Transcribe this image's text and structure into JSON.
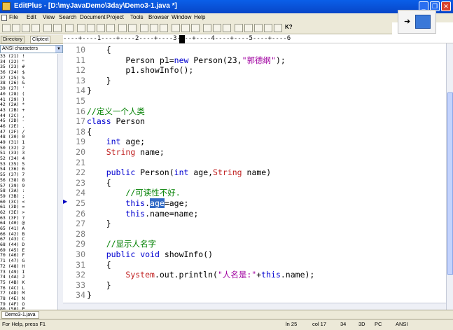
{
  "title_bar": {
    "title": "EditPlus - [D:\\myJavaDemo\\3day\\Demo3-1.java *]",
    "minimize": "_",
    "restore": "❐",
    "close": "✕"
  },
  "menu": {
    "items": [
      "File",
      "Edit",
      "View",
      "Search",
      "Document",
      "Project",
      "Tools",
      "Browser",
      "Window",
      "Help"
    ]
  },
  "toolbar": {
    "help_label": "K?"
  },
  "left_panel": {
    "tabs": [
      "Directory",
      "Cliptext"
    ],
    "selected_list": "ANSI characters",
    "chars": [
      [
        "33 (21)",
        "!"
      ],
      [
        "34 (22)",
        "\""
      ],
      [
        "35 (23)",
        "#"
      ],
      [
        "36 (24)",
        "$"
      ],
      [
        "37 (25)",
        "%"
      ],
      [
        "38 (26)",
        "&"
      ],
      [
        "39 (27)",
        "'"
      ],
      [
        "40 (28)",
        "("
      ],
      [
        "41 (29)",
        ")"
      ],
      [
        "42 (2A)",
        "*"
      ],
      [
        "43 (2B)",
        "+"
      ],
      [
        "44 (2C)",
        ","
      ],
      [
        "45 (2D)",
        "-"
      ],
      [
        "46 (2E)",
        "."
      ],
      [
        "47 (2F)",
        "/"
      ],
      [
        "48 (30)",
        "0"
      ],
      [
        "49 (31)",
        "1"
      ],
      [
        "50 (32)",
        "2"
      ],
      [
        "51 (33)",
        "3"
      ],
      [
        "52 (34)",
        "4"
      ],
      [
        "53 (35)",
        "5"
      ],
      [
        "54 (36)",
        "6"
      ],
      [
        "55 (37)",
        "7"
      ],
      [
        "56 (38)",
        "8"
      ],
      [
        "57 (39)",
        "9"
      ],
      [
        "58 (3A)",
        ":"
      ],
      [
        "59 (3B)",
        ";"
      ],
      [
        "60 (3C)",
        "<"
      ],
      [
        "61 (3D)",
        "="
      ],
      [
        "62 (3E)",
        ">"
      ],
      [
        "63 (3F)",
        "?"
      ],
      [
        "64 (40)",
        "@"
      ],
      [
        "65 (41)",
        "A"
      ],
      [
        "66 (42)",
        "B"
      ],
      [
        "67 (43)",
        "C"
      ],
      [
        "68 (44)",
        "D"
      ],
      [
        "69 (45)",
        "E"
      ],
      [
        "70 (46)",
        "F"
      ],
      [
        "71 (47)",
        "G"
      ],
      [
        "72 (48)",
        "H"
      ],
      [
        "73 (49)",
        "I"
      ],
      [
        "74 (4A)",
        "J"
      ],
      [
        "75 (4B)",
        "K"
      ],
      [
        "76 (4C)",
        "L"
      ],
      [
        "77 (4D)",
        "M"
      ],
      [
        "78 (4E)",
        "N"
      ],
      [
        "79 (4F)",
        "O"
      ],
      [
        "80 (50)",
        "P"
      ]
    ]
  },
  "ruler": {
    "text": "----+----1----+----2----+----3----+----4----+----5----+----6"
  },
  "code_lines": [
    {
      "n": "10",
      "indent": "    ",
      "parts": [
        [
          "p",
          "{"
        ]
      ]
    },
    {
      "n": "11",
      "indent": "        ",
      "parts": [
        [
          "p",
          "Person p1="
        ],
        [
          "kw",
          "new"
        ],
        [
          "p",
          " Person(23,"
        ],
        [
          "str",
          "\"郭德纲\""
        ],
        [
          "p",
          ");"
        ]
      ]
    },
    {
      "n": "12",
      "indent": "        ",
      "parts": [
        [
          "p",
          "p1.showInfo();"
        ]
      ]
    },
    {
      "n": "13",
      "indent": "    ",
      "parts": [
        [
          "p",
          "}"
        ]
      ]
    },
    {
      "n": "14",
      "indent": "",
      "parts": [
        [
          "p",
          "}"
        ]
      ]
    },
    {
      "n": "15",
      "indent": "",
      "parts": []
    },
    {
      "n": "16",
      "indent": "",
      "parts": [
        [
          "cmt",
          "//定义一个人类"
        ]
      ]
    },
    {
      "n": "17",
      "indent": "",
      "parts": [
        [
          "kw",
          "class"
        ],
        [
          "p",
          " Person"
        ]
      ]
    },
    {
      "n": "18",
      "indent": "",
      "parts": [
        [
          "p",
          "{"
        ]
      ]
    },
    {
      "n": "19",
      "indent": "    ",
      "parts": [
        [
          "kw",
          "int"
        ],
        [
          "p",
          " age;"
        ]
      ]
    },
    {
      "n": "20",
      "indent": "    ",
      "parts": [
        [
          "ty",
          "String"
        ],
        [
          "p",
          " name;"
        ]
      ]
    },
    {
      "n": "21",
      "indent": "",
      "parts": []
    },
    {
      "n": "22",
      "indent": "    ",
      "parts": [
        [
          "kw",
          "public"
        ],
        [
          "p",
          " Person("
        ],
        [
          "kw",
          "int"
        ],
        [
          "p",
          " age,"
        ],
        [
          "ty",
          "String"
        ],
        [
          "p",
          " name)"
        ]
      ]
    },
    {
      "n": "23",
      "indent": "    ",
      "parts": [
        [
          "p",
          "{"
        ]
      ]
    },
    {
      "n": "24",
      "indent": "        ",
      "parts": [
        [
          "cmt",
          "//可读性不好."
        ]
      ]
    },
    {
      "n": "25",
      "indent": "        ",
      "parts": [
        [
          "kw",
          "this"
        ],
        [
          "p",
          "."
        ],
        [
          "sel",
          "age"
        ],
        [
          "p",
          "=age;"
        ]
      ]
    },
    {
      "n": "26",
      "indent": "        ",
      "parts": [
        [
          "kw",
          "this"
        ],
        [
          "p",
          ".name=name;"
        ]
      ]
    },
    {
      "n": "27",
      "indent": "    ",
      "parts": [
        [
          "p",
          "}"
        ]
      ]
    },
    {
      "n": "28",
      "indent": "",
      "parts": []
    },
    {
      "n": "29",
      "indent": "    ",
      "parts": [
        [
          "cmt",
          "//显示人名字"
        ]
      ]
    },
    {
      "n": "30",
      "indent": "    ",
      "parts": [
        [
          "kw",
          "public"
        ],
        [
          "p",
          " "
        ],
        [
          "kw",
          "void"
        ],
        [
          "p",
          " showInfo()"
        ]
      ]
    },
    {
      "n": "31",
      "indent": "    ",
      "parts": [
        [
          "p",
          "{"
        ]
      ]
    },
    {
      "n": "32",
      "indent": "        ",
      "parts": [
        [
          "ty",
          "System"
        ],
        [
          "p",
          ".out.println("
        ],
        [
          "str",
          "\"人名是:\""
        ],
        [
          "p",
          "+"
        ],
        [
          "kw",
          "this"
        ],
        [
          "p",
          ".name);"
        ]
      ]
    },
    {
      "n": "33",
      "indent": "    ",
      "parts": [
        [
          "p",
          "}"
        ]
      ]
    },
    {
      "n": "34",
      "indent": "",
      "parts": [
        [
          "p",
          "}"
        ]
      ]
    }
  ],
  "file_tab": {
    "label": "Demo3-1.java"
  },
  "status_bar": {
    "help": "For Help, press F1",
    "line": "ln 25",
    "col": "col 17",
    "num1": "34",
    "num2": "3D",
    "mode": "PC",
    "encoding": "ANSI"
  }
}
